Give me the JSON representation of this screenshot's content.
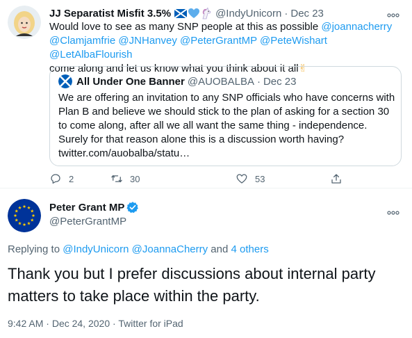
{
  "tweet1": {
    "name": "JJ Separatist Misfit 3.5%",
    "emojis": [
      "scotland-flag-icon",
      "blue-heart-icon",
      "unicorn-icon"
    ],
    "handle": "@IndyUnicorn",
    "separator": "·",
    "date": "Dec 23",
    "text_prefix": "Would love to see as many SNP people at this as possible ",
    "mentions": [
      "@joannacherry",
      "@Clamjamfrie",
      "@JNHanvey",
      "@PeterGrantMP",
      "@PeteWishart",
      "@LetAlbaFlourish"
    ],
    "text_suffix": "come along and let us know what you think about it all",
    "text_emoji": "✌",
    "quote": {
      "name": "All Under One Banner",
      "handle": "@AUOBALBA",
      "separator": "·",
      "date": "Dec 23",
      "text": "We are offering an invitation to any SNP officials who have concerns with Plan B and believe we should stick to the plan of asking for a section 30 to come along, after all we all want the same thing - independence. Surely for that reason alone this is a discussion worth having? twitter.com/auobalba/statu…"
    },
    "actions": {
      "replies": "2",
      "retweets": "30",
      "likes": "53"
    }
  },
  "tweet2": {
    "name": "Peter Grant MP",
    "handle": "@PeterGrantMP",
    "replying_label": "Replying to ",
    "replying_mentions": [
      "@IndyUnicorn",
      "@JoannaCherry"
    ],
    "replying_and": " and ",
    "replying_others": "4 others",
    "text": "Thank you but I prefer discussions about internal party matters to take place within the party.",
    "time": "9:42 AM",
    "date": "Dec 24, 2020",
    "source": "Twitter for iPad",
    "separator": "·"
  },
  "colors": {
    "accent": "#1d9bf0",
    "muted": "#536471",
    "text": "#0f1419",
    "border": "#cfd9de",
    "eu_blue": "#003399",
    "eu_star": "#ffcc00"
  }
}
